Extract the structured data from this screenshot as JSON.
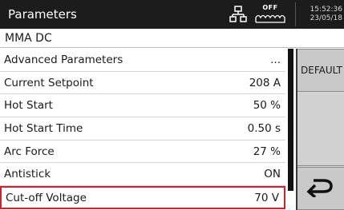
{
  "header": {
    "title": "Parameters",
    "network_icon": "network-icon",
    "arc_status": "OFF",
    "time": "15:52:36",
    "date": "23/05/18"
  },
  "process": {
    "name": "MMA DC"
  },
  "parameters": [
    {
      "label": "Advanced Parameters",
      "value": "..."
    },
    {
      "label": "Current Setpoint",
      "value": "208 A"
    },
    {
      "label": "Hot Start",
      "value": "50 %"
    },
    {
      "label": "Hot Start Time",
      "value": "0.50 s"
    },
    {
      "label": "Arc Force",
      "value": "27 %"
    },
    {
      "label": "Antistick",
      "value": "ON"
    },
    {
      "label": "Cut-off Voltage",
      "value": "70 V"
    }
  ],
  "selected_index": 6,
  "side_buttons": {
    "default_label": "DEFAULT",
    "back_icon": "return-arrow-icon"
  },
  "colors": {
    "titlebar_bg": "#1c1c1c",
    "selection_border": "#d4202a",
    "side_panel": "#d9d9d9"
  }
}
